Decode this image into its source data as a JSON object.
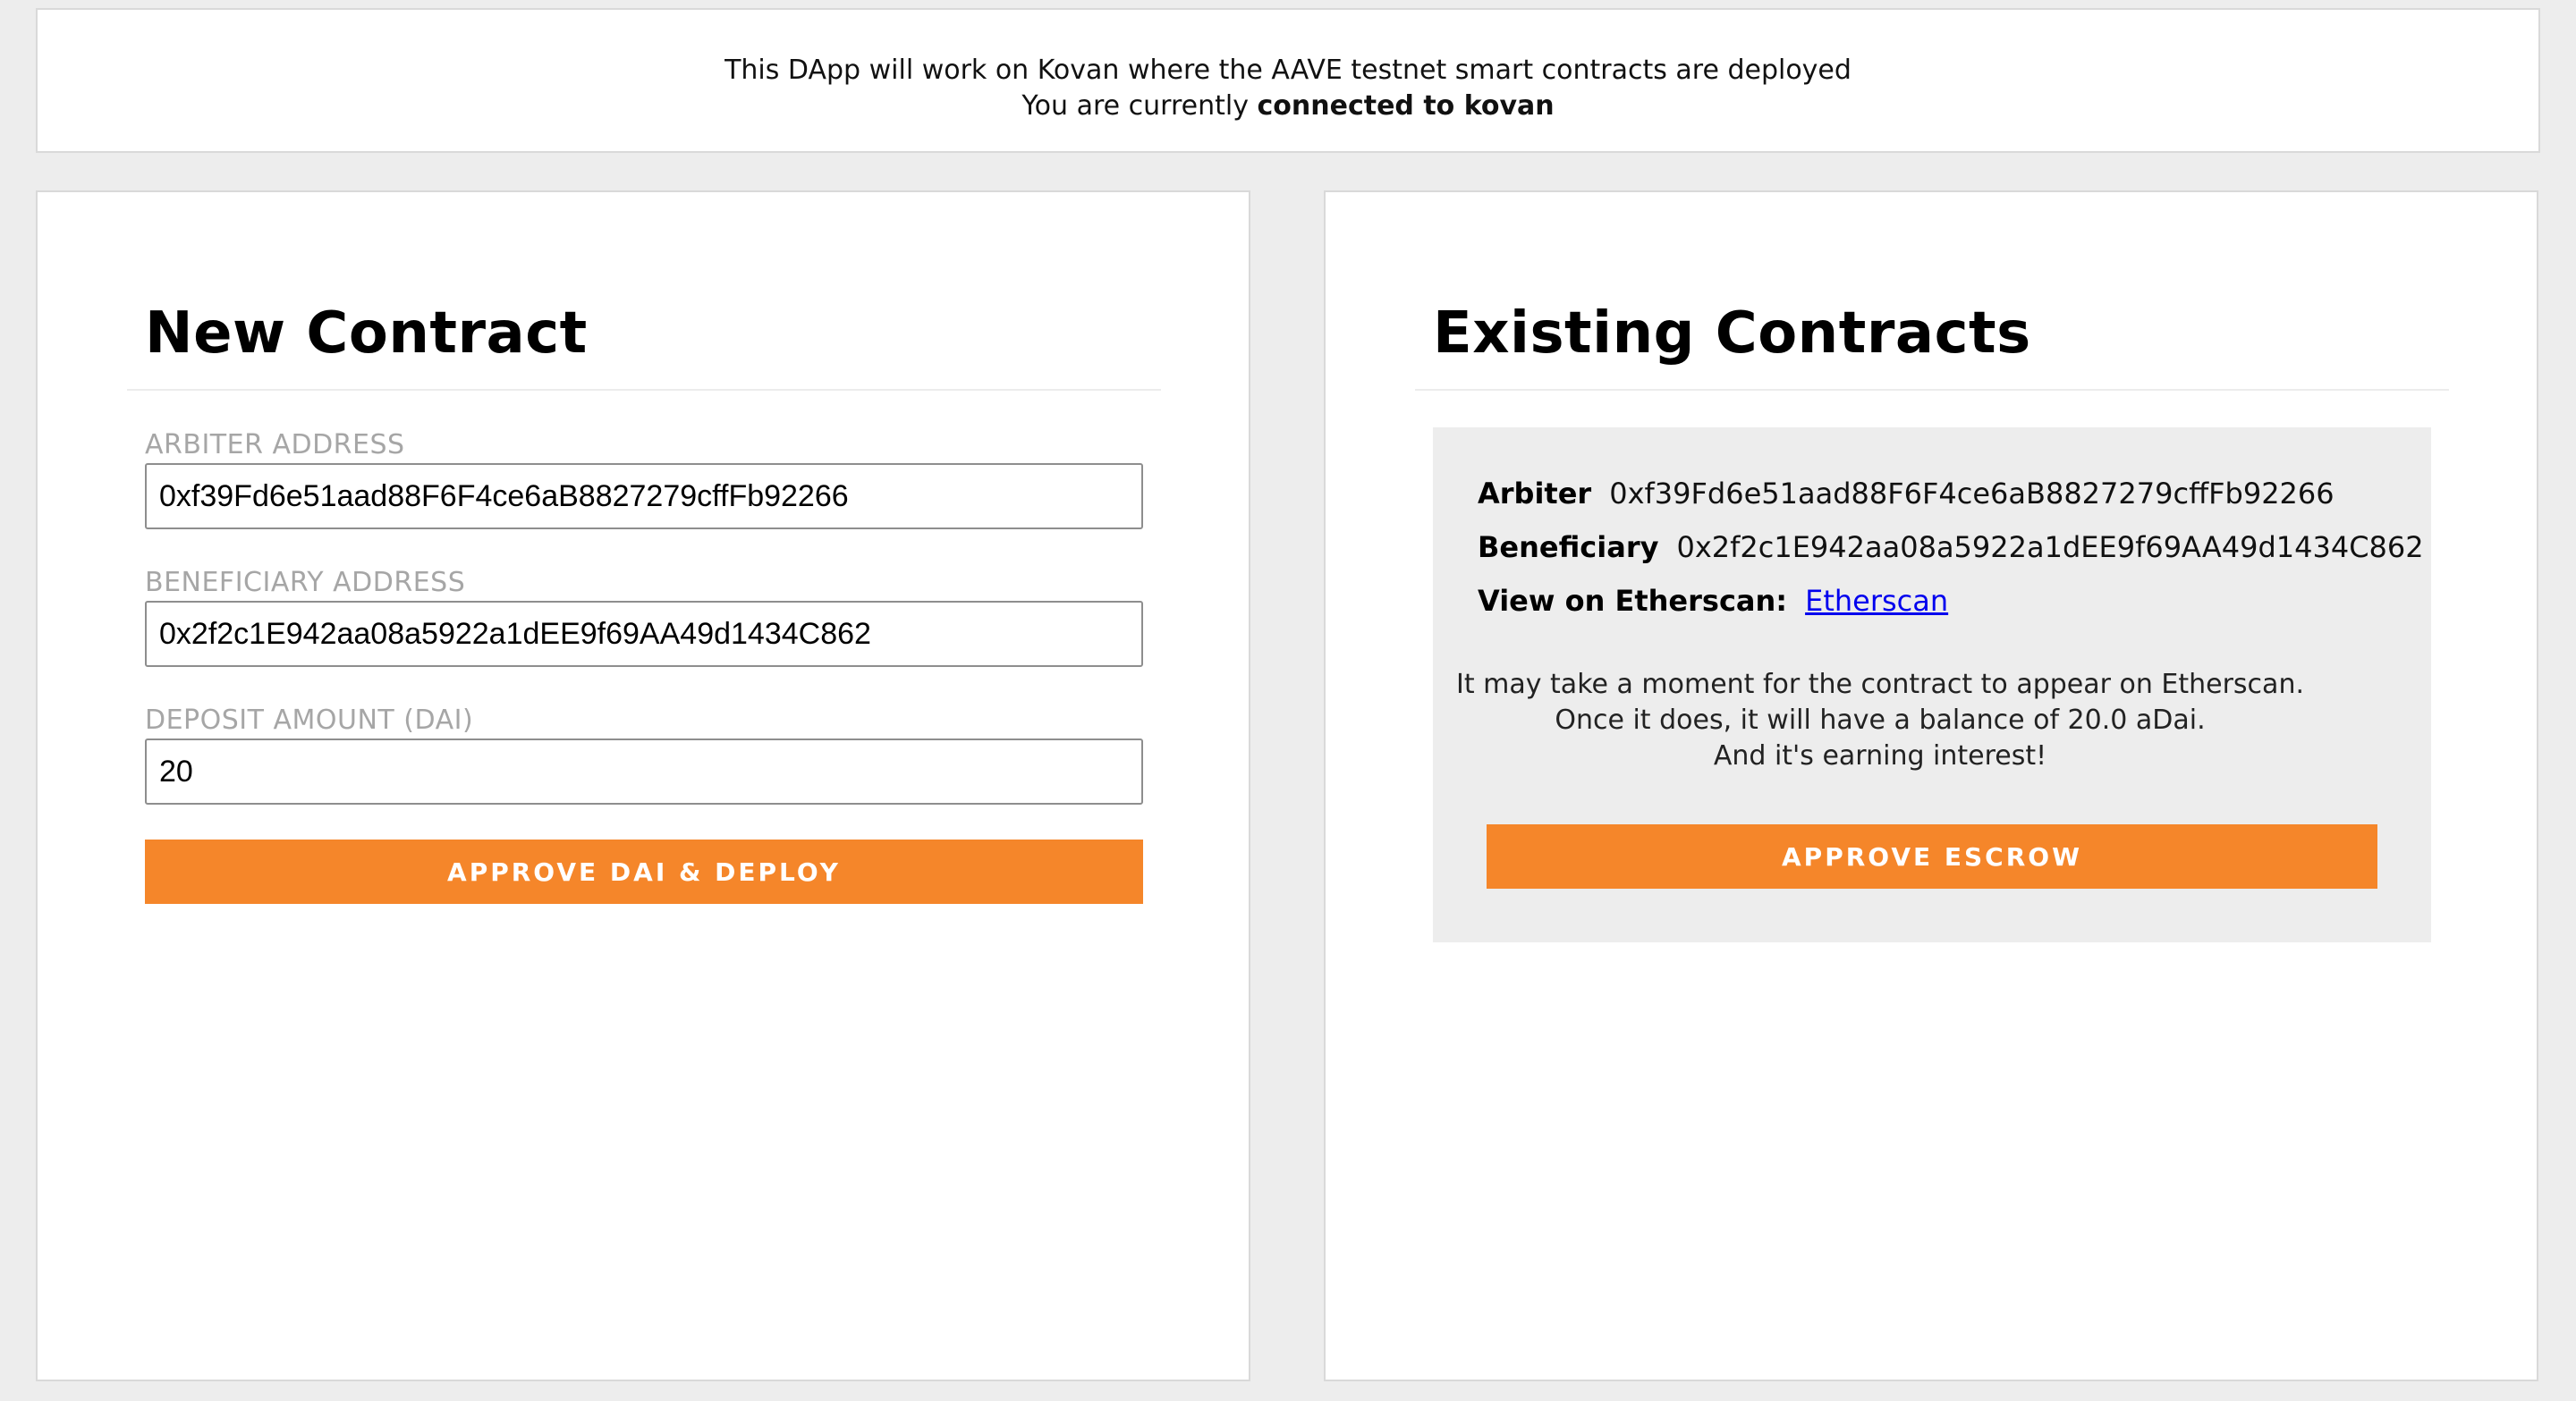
{
  "banner": {
    "line1": "This DApp will work on Kovan where the AAVE testnet smart contracts are deployed",
    "line2_prefix": "You are currently ",
    "line2_status": "connected to kovan"
  },
  "new_contract": {
    "title": "New Contract",
    "arbiter_label": "Arbiter Address",
    "arbiter_value": "0xf39Fd6e51aad88F6F4ce6aB8827279cffFb92266",
    "beneficiary_label": "Beneficiary Address",
    "beneficiary_value": "0x2f2c1E942aa08a5922a1dEE9f69AA49d1434C862",
    "deposit_label": "Deposit Amount (DAI)",
    "deposit_value": "20",
    "submit_label": "Approve DAI & Deploy"
  },
  "existing_contracts": {
    "title": "Existing Contracts",
    "contracts": [
      {
        "arbiter_label": "Arbiter",
        "arbiter": "0xf39Fd6e51aad88F6F4ce6aB8827279cffFb92266",
        "beneficiary_label": "Beneficiary",
        "beneficiary": "0x2f2c1E942aa08a5922a1dEE9f69AA49d1434C862",
        "etherscan_label": "View on Etherscan:",
        "etherscan_link_text": "Etherscan",
        "note_line1": "It may take a moment for the contract to appear on Etherscan.",
        "note_line2": "Once it does, it will have a balance of 20.0 aDai.",
        "note_line3": "And it's earning interest!",
        "approve_label": "Approve Escrow"
      }
    ]
  },
  "colors": {
    "accent": "#f5862a",
    "page_background": "#ededed",
    "link": "#0000ee"
  }
}
